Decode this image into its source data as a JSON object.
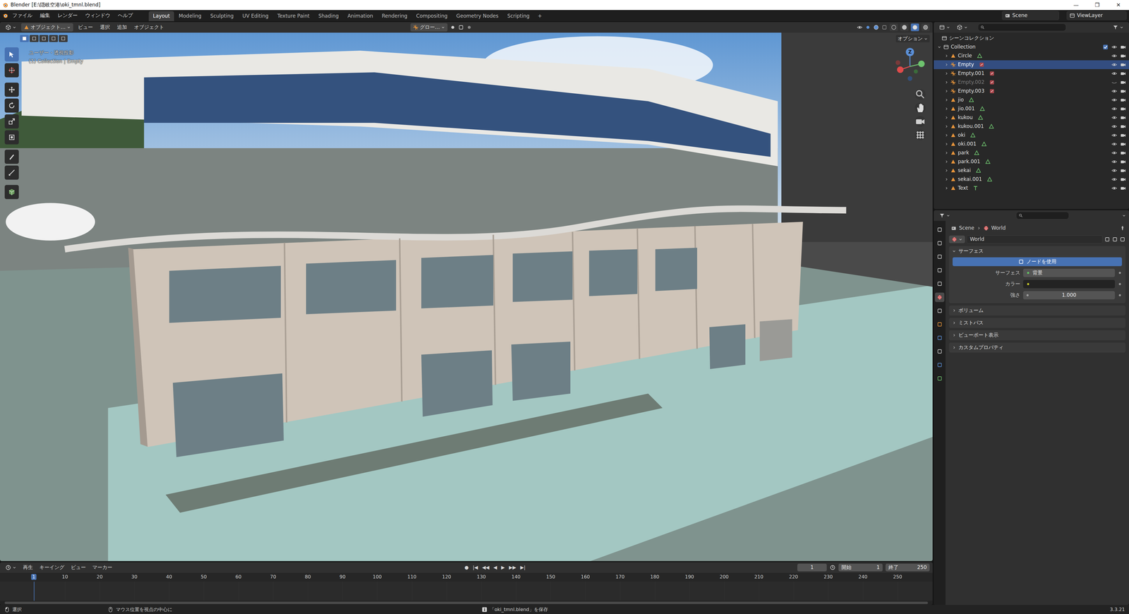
{
  "window": {
    "title": "Blender [E:\\隠岐空港\\oki_tmnl.blend]",
    "controls": [
      "—",
      "❐",
      "✕"
    ]
  },
  "menu": [
    "ファイル",
    "編集",
    "レンダー",
    "ウィンドウ",
    "ヘルプ"
  ],
  "workspaces": [
    {
      "label": "Layout",
      "selected": true
    },
    {
      "label": "Modeling",
      "selected": false
    },
    {
      "label": "Sculpting",
      "selected": false
    },
    {
      "label": "UV Editing",
      "selected": false
    },
    {
      "label": "Texture Paint",
      "selected": false
    },
    {
      "label": "Shading",
      "selected": false
    },
    {
      "label": "Animation",
      "selected": false
    },
    {
      "label": "Rendering",
      "selected": false
    },
    {
      "label": "Compositing",
      "selected": false
    },
    {
      "label": "Geometry Nodes",
      "selected": false
    },
    {
      "label": "Scripting",
      "selected": false
    }
  ],
  "add_workspace": "+",
  "topbar_right": {
    "scene": "Scene",
    "view_layer": "ViewLayer"
  },
  "viewport": {
    "mode": "オブジェクト…",
    "menus": [
      "ビュー",
      "選択",
      "追加",
      "オブジェクト"
    ],
    "orientation": "グロー…",
    "select_modes": [
      {
        "selected": true
      },
      {
        "selected": false
      },
      {
        "selected": false
      },
      {
        "selected": false
      },
      {
        "selected": false
      }
    ],
    "shading": [
      {
        "selected": false
      },
      {
        "selected": false
      },
      {
        "selected": true
      },
      {
        "selected": false
      }
    ],
    "view_name": "ユーザー・透視投影",
    "info": "(1) Collection | Empty",
    "options": "オプション",
    "gizmo_label": "Z"
  },
  "tools": [
    {
      "selected": true
    },
    {
      "selected": false
    },
    {
      "selected": false
    },
    {
      "selected": false
    },
    {
      "selected": false
    },
    {
      "selected": false
    },
    {
      "selected": false
    },
    {
      "selected": false
    },
    {
      "selected": false
    }
  ],
  "outliner": {
    "root": "シーンコレクション",
    "collection": {
      "label": "Collection",
      "checked": true
    },
    "items": [
      {
        "label": "Circle",
        "kind": "mesh",
        "selected": false,
        "hidden": false
      },
      {
        "label": "Empty",
        "kind": "empty",
        "selected": true,
        "hidden": false
      },
      {
        "label": "Empty.001",
        "kind": "empty",
        "selected": false,
        "hidden": false
      },
      {
        "label": "Empty.002",
        "kind": "empty",
        "selected": false,
        "hidden": true
      },
      {
        "label": "Empty.003",
        "kind": "empty",
        "selected": false,
        "hidden": false
      },
      {
        "label": "jio",
        "kind": "mesh",
        "selected": false,
        "hidden": false
      },
      {
        "label": "jio.001",
        "kind": "mesh",
        "selected": false,
        "hidden": false
      },
      {
        "label": "kukou",
        "kind": "mesh",
        "selected": false,
        "hidden": false
      },
      {
        "label": "kukou.001",
        "kind": "mesh",
        "selected": false,
        "hidden": false
      },
      {
        "label": "oki",
        "kind": "mesh",
        "selected": false,
        "hidden": false
      },
      {
        "label": "oki.001",
        "kind": "mesh",
        "selected": false,
        "hidden": false
      },
      {
        "label": "park",
        "kind": "mesh",
        "selected": false,
        "hidden": false
      },
      {
        "label": "park.001",
        "kind": "mesh",
        "selected": false,
        "hidden": false
      },
      {
        "label": "sekai",
        "kind": "mesh",
        "selected": false,
        "hidden": false
      },
      {
        "label": "sekai.001",
        "kind": "mesh",
        "selected": false,
        "hidden": false
      },
      {
        "label": "Text",
        "kind": "text",
        "selected": false,
        "hidden": false
      }
    ]
  },
  "properties": {
    "tabs": [
      {
        "selected": false
      },
      {
        "selected": false
      },
      {
        "selected": false
      },
      {
        "selected": false
      },
      {
        "selected": false
      },
      {
        "selected": true
      },
      {
        "selected": false
      },
      {
        "selected": false
      },
      {
        "selected": false
      },
      {
        "selected": false
      },
      {
        "selected": false
      },
      {
        "selected": false
      }
    ],
    "breadcrumb": [
      "Scene",
      "World"
    ],
    "datablock": "World",
    "surface_panel": "サーフェス",
    "use_nodes": "ノードを使用",
    "fields": [
      {
        "label": "サーフェス",
        "value": "背景",
        "kind": "shader"
      },
      {
        "label": "カラー",
        "value": "",
        "kind": "color"
      },
      {
        "label": "強さ",
        "value": "1.000",
        "kind": "number"
      }
    ],
    "panels": [
      {
        "label": "ボリューム",
        "expanded": false
      },
      {
        "label": "ミストパス",
        "expanded": false
      },
      {
        "label": "ビューポート表示",
        "expanded": false
      },
      {
        "label": "カスタムプロパティ",
        "expanded": false
      }
    ]
  },
  "timeline": {
    "menus": [
      "再生",
      "キーイング",
      "ビュー",
      "マーカー"
    ],
    "record": "●",
    "controls": [
      "|◀",
      "◀◀",
      "◀",
      "▶",
      "▶▶",
      "▶|"
    ],
    "current_frame": "1",
    "start_label": "開始",
    "start": "1",
    "end_label": "終了",
    "end": "250",
    "ticks": [
      {
        "label": "1",
        "current": true
      },
      {
        "label": "10",
        "current": false
      },
      {
        "label": "20",
        "current": false
      },
      {
        "label": "30",
        "current": false
      },
      {
        "label": "40",
        "current": false
      },
      {
        "label": "50",
        "current": false
      },
      {
        "label": "60",
        "current": false
      },
      {
        "label": "70",
        "current": false
      },
      {
        "label": "80",
        "current": false
      },
      {
        "label": "90",
        "current": false
      },
      {
        "label": "100",
        "current": false
      },
      {
        "label": "110",
        "current": false
      },
      {
        "label": "120",
        "current": false
      },
      {
        "label": "130",
        "current": false
      },
      {
        "label": "140",
        "current": false
      },
      {
        "label": "150",
        "current": false
      },
      {
        "label": "160",
        "current": false
      },
      {
        "label": "170",
        "current": false
      },
      {
        "label": "180",
        "current": false
      },
      {
        "label": "190",
        "current": false
      },
      {
        "label": "200",
        "current": false
      },
      {
        "label": "210",
        "current": false
      },
      {
        "label": "220",
        "current": false
      },
      {
        "label": "230",
        "current": false
      },
      {
        "label": "240",
        "current": false
      },
      {
        "label": "250",
        "current": false
      }
    ]
  },
  "status_bar": {
    "hints": [
      "選択",
      "マウス位置を視点の中心に"
    ],
    "message": "「oki_tmnl.blend」を保存",
    "version": "3.3.21"
  }
}
